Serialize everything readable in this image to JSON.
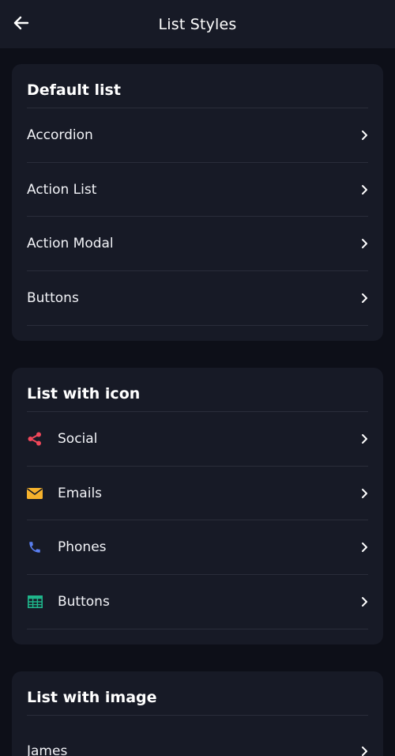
{
  "header": {
    "title": "List Styles",
    "back_icon": "arrow-left-icon"
  },
  "sections": [
    {
      "title": "Default list",
      "items": [
        {
          "label": "Accordion"
        },
        {
          "label": "Action List"
        },
        {
          "label": "Action Modal"
        },
        {
          "label": "Buttons"
        }
      ]
    },
    {
      "title": "List with icon",
      "items": [
        {
          "label": "Social",
          "icon": "share-icon",
          "color": "#f0475a"
        },
        {
          "label": "Emails",
          "icon": "envelope-icon",
          "color": "#f6b22c"
        },
        {
          "label": "Phones",
          "icon": "phone-icon",
          "color": "#5a7ff2"
        },
        {
          "label": "Buttons",
          "icon": "table-icon",
          "color": "#1fb58a"
        }
      ]
    },
    {
      "title": "List with image",
      "items": [
        {
          "label": "James"
        }
      ]
    }
  ],
  "colors": {
    "background": "#0d0f18",
    "surface": "#171a26",
    "divider": "#2a2d3a"
  }
}
